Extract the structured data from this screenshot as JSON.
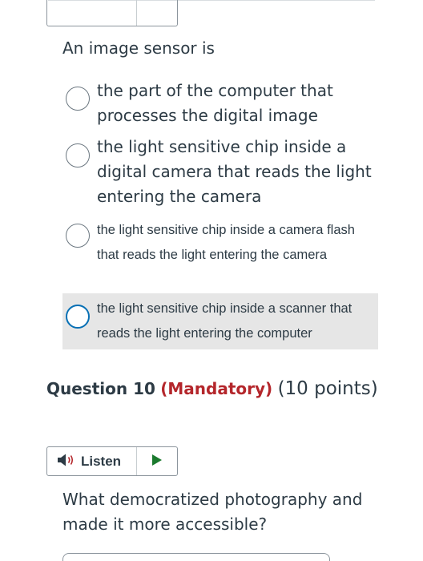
{
  "question9": {
    "prompt": "An image sensor is",
    "answers": [
      {
        "label": "the part of the computer that processes the digital image",
        "selected": false
      },
      {
        "label": "the light sensitive chip inside a digital camera that reads the light entering the camera",
        "selected": false
      },
      {
        "label": "the light sensitive chip inside a camera flash that reads the light entering the camera",
        "selected": false
      },
      {
        "label": "the light sensitive chip inside a scanner that reads the light entering the computer",
        "selected": false,
        "highlighted": true
      }
    ]
  },
  "question10": {
    "number_label": "Question 10",
    "mandatory_label": "(Mandatory)",
    "points_label": "(10 points)",
    "listen_label": "Listen",
    "prompt": "What democratized photography and made it more accessible?"
  },
  "colors": {
    "text": "#2d3b45",
    "mandatory": "#b4262b",
    "focus_ring": "#0770b5",
    "highlight_bg": "#e6e6e6",
    "play": "#1b7a2e"
  },
  "icons": {
    "speaker": "speaker-icon",
    "play": "play-icon"
  }
}
